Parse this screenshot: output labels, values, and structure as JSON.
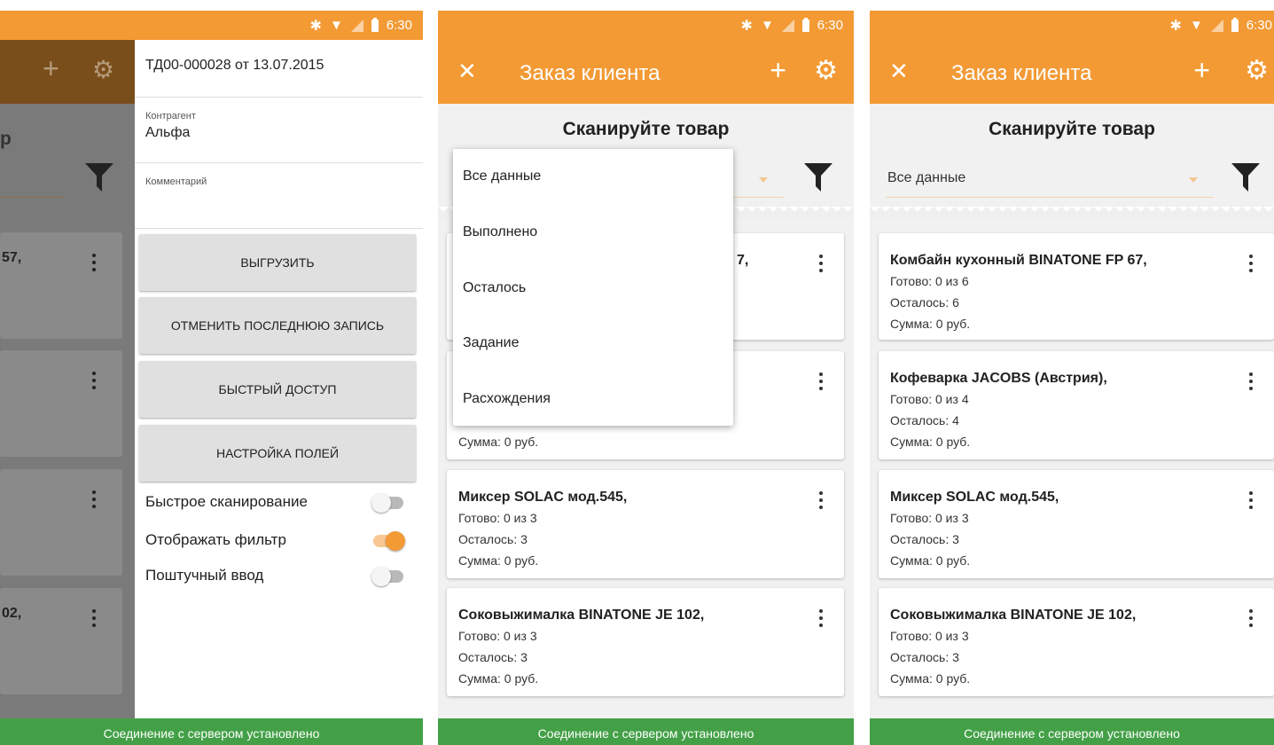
{
  "status_bar": {
    "time": "6:30",
    "icons": [
      "bluetooth-icon",
      "wifi-icon",
      "signal-icon",
      "battery-icon"
    ]
  },
  "app": {
    "title": "Заказ клиента",
    "accent_color": "#f39a35",
    "footer_color": "#43a047"
  },
  "scan_title": "Сканируйте товар",
  "filter": {
    "selected": "Все данные",
    "options": [
      "Все данные",
      "Выполнено",
      "Осталось",
      "Задание",
      "Расхождения"
    ]
  },
  "cards": [
    {
      "name": "Комбайн кухонный BINATONE FP 67,",
      "ready": "Готово: 0 из 6",
      "left": "Осталось: 6",
      "sum": "Сумма: 0 руб."
    },
    {
      "name": "Кофеварка JACOBS (Австрия),",
      "ready": "Готово: 0 из 4",
      "left": "Осталось: 4",
      "sum": "Сумма: 0 руб."
    },
    {
      "name": "Миксер SOLAC мод.545,",
      "ready": "Готово: 0 из 3",
      "left": "Осталось: 3",
      "sum": "Сумма: 0 руб."
    },
    {
      "name": "Соковыжималка  BINATONE JE 102,",
      "ready": "Готово: 0 из 3",
      "left": "Осталось: 3",
      "sum": "Сумма: 0 руб."
    }
  ],
  "panel2_card1_name_tail": "7,",
  "panel1_behind": {
    "title_fragment": "р",
    "card1_fragment": "57,",
    "card4_fragment": "02,"
  },
  "drawer": {
    "doc_number": "ТД00-000028 от 13.07.2015",
    "contractor_label": "Контрагент",
    "contractor_value": "Альфа",
    "comment_label": "Комментарий",
    "comment_value": "",
    "buttons": [
      "ВЫГРУЗИТЬ",
      "ОТМЕНИТЬ ПОСЛЕДНЮЮ ЗАПИСЬ",
      "БЫСТРЫЙ ДОСТУП",
      "НАСТРОЙКА ПОЛЕЙ"
    ],
    "toggles": [
      {
        "label": "Быстрое сканирование",
        "on": false
      },
      {
        "label": "Отображать фильтр",
        "on": true
      },
      {
        "label": "Поштучный ввод",
        "on": false
      }
    ]
  },
  "footer": "Соединение с сервером установлено"
}
